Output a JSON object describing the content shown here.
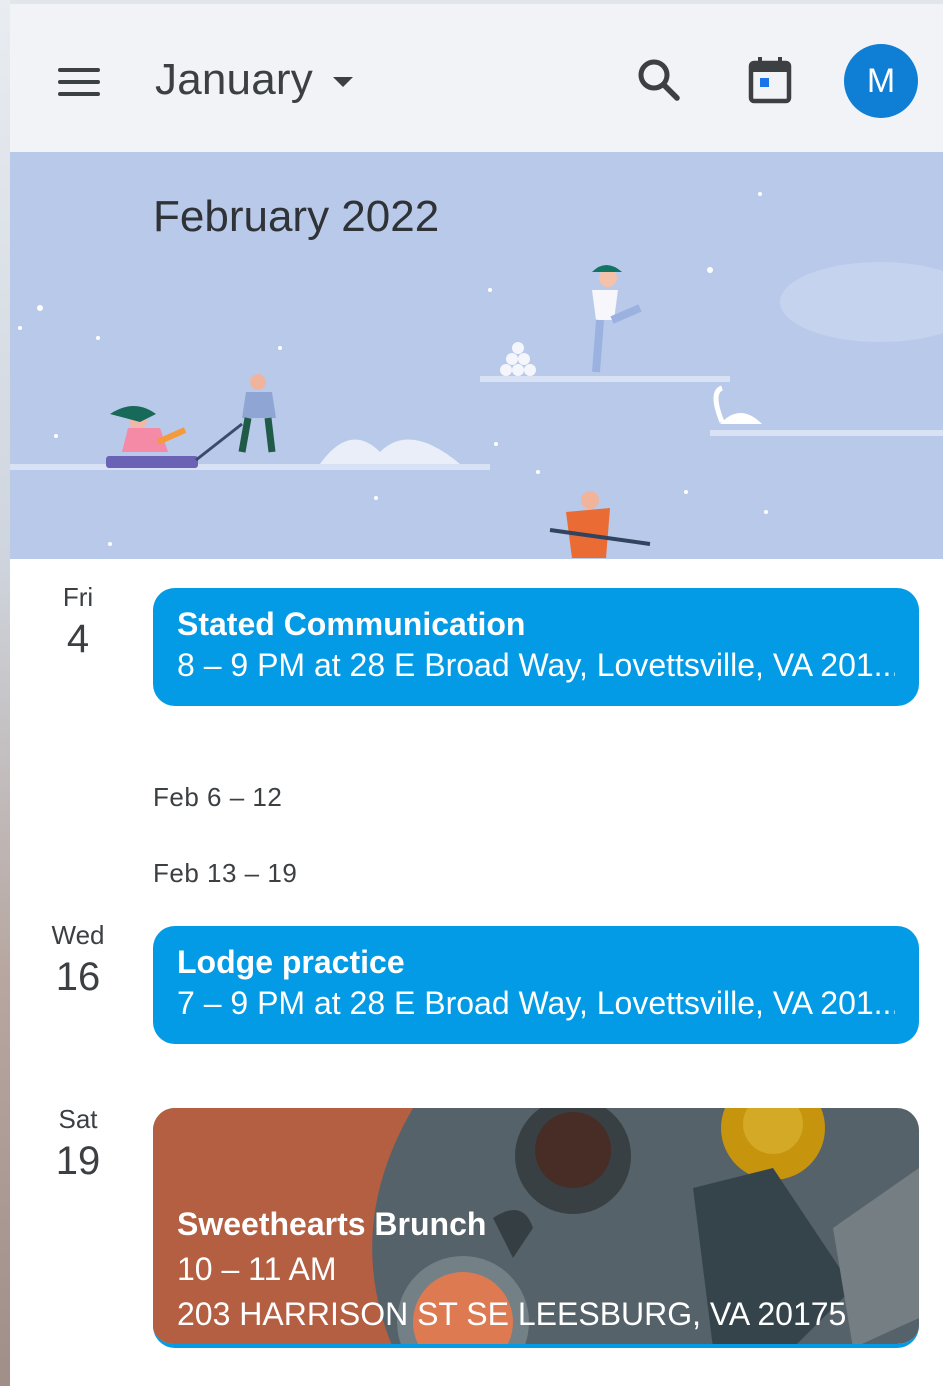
{
  "header": {
    "month": "January",
    "avatar_initial": "M",
    "menu_icon": "menu-icon",
    "search_icon": "search-icon",
    "today_icon": "calendar-today-icon",
    "accent": "#0f7fd6"
  },
  "banner": {
    "title": "February 2022",
    "background": "#b8c8e8"
  },
  "schedule": {
    "days": [
      {
        "dow": "Fri",
        "dom": "4"
      },
      {
        "dow": "Wed",
        "dom": "16"
      },
      {
        "dow": "Sat",
        "dom": "19"
      }
    ],
    "weeks": [
      "Feb 6 – 12",
      "Feb 13 – 19"
    ],
    "events": [
      {
        "title": "Stated Communication",
        "detail": "8 – 9 PM at 28 E Broad Way, Lovettsville, VA 201..."
      },
      {
        "title": "Lodge practice",
        "detail": "7 – 9 PM at 28 E Broad Way, Lovettsville, VA 201..."
      },
      {
        "title": "Sweethearts Brunch",
        "time": "10 – 11 AM",
        "location": "203 HARRISON ST SE LEESBURG, VA 20175"
      }
    ],
    "event_color": "#039be5"
  }
}
